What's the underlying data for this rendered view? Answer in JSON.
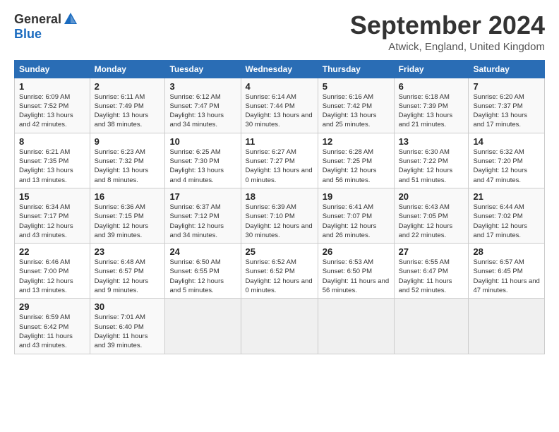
{
  "header": {
    "logo_general": "General",
    "logo_blue": "Blue",
    "month_title": "September 2024",
    "location": "Atwick, England, United Kingdom"
  },
  "days_of_week": [
    "Sunday",
    "Monday",
    "Tuesday",
    "Wednesday",
    "Thursday",
    "Friday",
    "Saturday"
  ],
  "weeks": [
    [
      {
        "day": "1",
        "sunrise": "6:09 AM",
        "sunset": "7:52 PM",
        "daylight": "13 hours and 42 minutes."
      },
      {
        "day": "2",
        "sunrise": "6:11 AM",
        "sunset": "7:49 PM",
        "daylight": "13 hours and 38 minutes."
      },
      {
        "day": "3",
        "sunrise": "6:12 AM",
        "sunset": "7:47 PM",
        "daylight": "13 hours and 34 minutes."
      },
      {
        "day": "4",
        "sunrise": "6:14 AM",
        "sunset": "7:44 PM",
        "daylight": "13 hours and 30 minutes."
      },
      {
        "day": "5",
        "sunrise": "6:16 AM",
        "sunset": "7:42 PM",
        "daylight": "13 hours and 25 minutes."
      },
      {
        "day": "6",
        "sunrise": "6:18 AM",
        "sunset": "7:39 PM",
        "daylight": "13 hours and 21 minutes."
      },
      {
        "day": "7",
        "sunrise": "6:20 AM",
        "sunset": "7:37 PM",
        "daylight": "13 hours and 17 minutes."
      }
    ],
    [
      {
        "day": "8",
        "sunrise": "6:21 AM",
        "sunset": "7:35 PM",
        "daylight": "13 hours and 13 minutes."
      },
      {
        "day": "9",
        "sunrise": "6:23 AM",
        "sunset": "7:32 PM",
        "daylight": "13 hours and 8 minutes."
      },
      {
        "day": "10",
        "sunrise": "6:25 AM",
        "sunset": "7:30 PM",
        "daylight": "13 hours and 4 minutes."
      },
      {
        "day": "11",
        "sunrise": "6:27 AM",
        "sunset": "7:27 PM",
        "daylight": "13 hours and 0 minutes."
      },
      {
        "day": "12",
        "sunrise": "6:28 AM",
        "sunset": "7:25 PM",
        "daylight": "12 hours and 56 minutes."
      },
      {
        "day": "13",
        "sunrise": "6:30 AM",
        "sunset": "7:22 PM",
        "daylight": "12 hours and 51 minutes."
      },
      {
        "day": "14",
        "sunrise": "6:32 AM",
        "sunset": "7:20 PM",
        "daylight": "12 hours and 47 minutes."
      }
    ],
    [
      {
        "day": "15",
        "sunrise": "6:34 AM",
        "sunset": "7:17 PM",
        "daylight": "12 hours and 43 minutes."
      },
      {
        "day": "16",
        "sunrise": "6:36 AM",
        "sunset": "7:15 PM",
        "daylight": "12 hours and 39 minutes."
      },
      {
        "day": "17",
        "sunrise": "6:37 AM",
        "sunset": "7:12 PM",
        "daylight": "12 hours and 34 minutes."
      },
      {
        "day": "18",
        "sunrise": "6:39 AM",
        "sunset": "7:10 PM",
        "daylight": "12 hours and 30 minutes."
      },
      {
        "day": "19",
        "sunrise": "6:41 AM",
        "sunset": "7:07 PM",
        "daylight": "12 hours and 26 minutes."
      },
      {
        "day": "20",
        "sunrise": "6:43 AM",
        "sunset": "7:05 PM",
        "daylight": "12 hours and 22 minutes."
      },
      {
        "day": "21",
        "sunrise": "6:44 AM",
        "sunset": "7:02 PM",
        "daylight": "12 hours and 17 minutes."
      }
    ],
    [
      {
        "day": "22",
        "sunrise": "6:46 AM",
        "sunset": "7:00 PM",
        "daylight": "12 hours and 13 minutes."
      },
      {
        "day": "23",
        "sunrise": "6:48 AM",
        "sunset": "6:57 PM",
        "daylight": "12 hours and 9 minutes."
      },
      {
        "day": "24",
        "sunrise": "6:50 AM",
        "sunset": "6:55 PM",
        "daylight": "12 hours and 5 minutes."
      },
      {
        "day": "25",
        "sunrise": "6:52 AM",
        "sunset": "6:52 PM",
        "daylight": "12 hours and 0 minutes."
      },
      {
        "day": "26",
        "sunrise": "6:53 AM",
        "sunset": "6:50 PM",
        "daylight": "11 hours and 56 minutes."
      },
      {
        "day": "27",
        "sunrise": "6:55 AM",
        "sunset": "6:47 PM",
        "daylight": "11 hours and 52 minutes."
      },
      {
        "day": "28",
        "sunrise": "6:57 AM",
        "sunset": "6:45 PM",
        "daylight": "11 hours and 47 minutes."
      }
    ],
    [
      {
        "day": "29",
        "sunrise": "6:59 AM",
        "sunset": "6:42 PM",
        "daylight": "11 hours and 43 minutes."
      },
      {
        "day": "30",
        "sunrise": "7:01 AM",
        "sunset": "6:40 PM",
        "daylight": "11 hours and 39 minutes."
      },
      null,
      null,
      null,
      null,
      null
    ]
  ]
}
